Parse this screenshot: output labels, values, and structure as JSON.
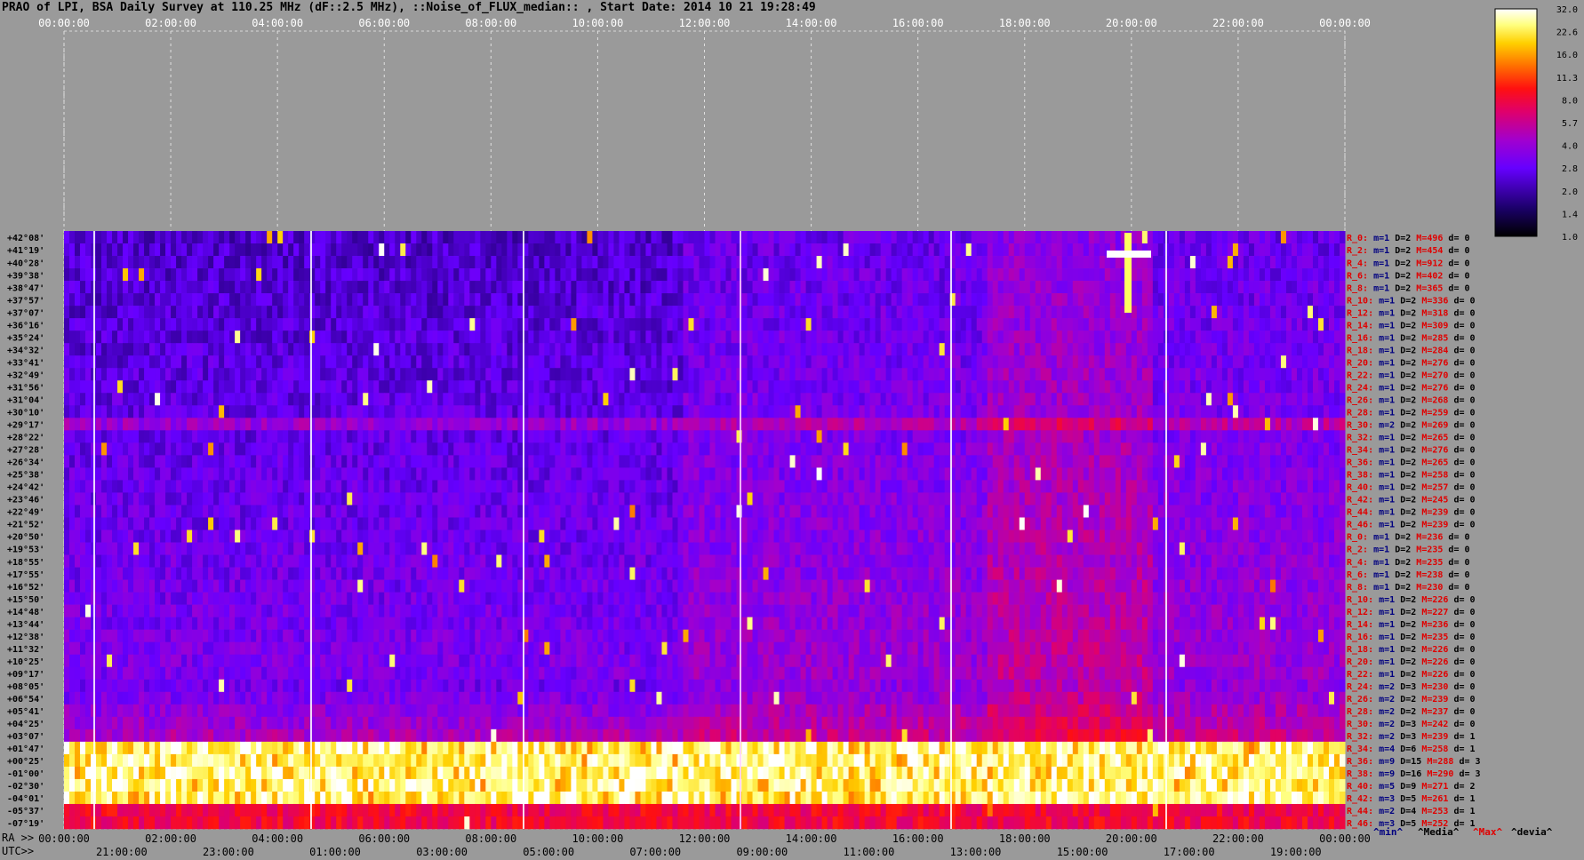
{
  "title": "PRAO of LPI, BSA Daily Survey at 110.25 MHz (dF::2.5 MHz), ::Noise_of_FLUX_median:: , Start Date: 2014 10 21 19:28:49",
  "axis_labels": {
    "ra": "RA >>",
    "utc": "UTC>>"
  },
  "legend_keys": {
    "min": "^min^",
    "median": "^Media^",
    "max": "^Max^",
    "dev": "^devia^"
  },
  "colors": {
    "background": "#9a9a9a",
    "low": "#000000",
    "mid": "#7a00ff",
    "high": "#ff0000",
    "peak": "#ffffff",
    "stat_red": "#e00000",
    "stat_blue": "#000080"
  },
  "chart_data": {
    "type": "heatmap",
    "x_ticks_top": [
      "00:00:00",
      "02:00:00",
      "04:00:00",
      "06:00:00",
      "08:00:00",
      "10:00:00",
      "12:00:00",
      "14:00:00",
      "16:00:00",
      "18:00:00",
      "20:00:00",
      "22:00:00",
      "00:00:00"
    ],
    "x_ticks_ra": [
      "00:00:00",
      "02:00:00",
      "04:00:00",
      "06:00:00",
      "08:00:00",
      "10:00:00",
      "12:00:00",
      "14:00:00",
      "16:00:00",
      "18:00:00",
      "20:00:00",
      "22:00:00",
      "00:00:00"
    ],
    "x_ticks_utc": [
      "21:00:00",
      "23:00:00",
      "01:00:00",
      "03:00:00",
      "05:00:00",
      "07:00:00",
      "09:00:00",
      "11:00:00",
      "13:00:00",
      "15:00:00",
      "17:00:00",
      "19:00:00"
    ],
    "y_labels": [
      "+42°08'",
      "+41°19'",
      "+40°28'",
      "+39°38'",
      "+38°47'",
      "+37°57'",
      "+37°07'",
      "+36°16'",
      "+35°24'",
      "+34°32'",
      "+33°41'",
      "+32°49'",
      "+31°56'",
      "+31°04'",
      "+30°10'",
      "+29°17'",
      "+28°22'",
      "+27°28'",
      "+26°34'",
      "+25°38'",
      "+24°42'",
      "+23°46'",
      "+22°49'",
      "+21°52'",
      "+20°50'",
      "+19°53'",
      "+18°55'",
      "+17°55'",
      "+16°52'",
      "+15°50'",
      "+14°48'",
      "+13°44'",
      "+12°38'",
      "+11°32'",
      "+10°25'",
      "+09°17'",
      "+08°05'",
      "+06°54'",
      "+05°41'",
      "+04°25'",
      "+03°07'",
      "+01°47'",
      "+00°25'",
      "-01°00'",
      "-02°30'",
      "-04°01'",
      "-05°37'",
      "-07°19'"
    ],
    "colorbar": {
      "ticks": [
        "32.0",
        "22.6",
        "16.0",
        "11.3",
        "8.0",
        "5.7",
        "4.0",
        "2.8",
        "2.0",
        "1.4",
        "1.0"
      ],
      "range": [
        1.0,
        32.0
      ],
      "scale": "log"
    },
    "row_stats": [
      {
        "r": "R_0:",
        "m": "m=1",
        "D": "D=2",
        "M": "M=496",
        "d": "d= 0"
      },
      {
        "r": "R_2:",
        "m": "m=1",
        "D": "D=2",
        "M": "M=454",
        "d": "d= 0"
      },
      {
        "r": "R_4:",
        "m": "m=1",
        "D": "D=2",
        "M": "M=912",
        "d": "d= 0"
      },
      {
        "r": "R_6:",
        "m": "m=1",
        "D": "D=2",
        "M": "M=402",
        "d": "d= 0"
      },
      {
        "r": "R_8:",
        "m": "m=1",
        "D": "D=2",
        "M": "M=365",
        "d": "d= 0"
      },
      {
        "r": "R_10:",
        "m": "m=1",
        "D": "D=2",
        "M": "M=336",
        "d": "d= 0"
      },
      {
        "r": "R_12:",
        "m": "m=1",
        "D": "D=2",
        "M": "M=318",
        "d": "d= 0"
      },
      {
        "r": "R_14:",
        "m": "m=1",
        "D": "D=2",
        "M": "M=309",
        "d": "d= 0"
      },
      {
        "r": "R_16:",
        "m": "m=1",
        "D": "D=2",
        "M": "M=285",
        "d": "d= 0"
      },
      {
        "r": "R_18:",
        "m": "m=1",
        "D": "D=2",
        "M": "M=284",
        "d": "d= 0"
      },
      {
        "r": "R_20:",
        "m": "m=1",
        "D": "D=2",
        "M": "M=276",
        "d": "d= 0"
      },
      {
        "r": "R_22:",
        "m": "m=1",
        "D": "D=2",
        "M": "M=270",
        "d": "d= 0"
      },
      {
        "r": "R_24:",
        "m": "m=1",
        "D": "D=2",
        "M": "M=276",
        "d": "d= 0"
      },
      {
        "r": "R_26:",
        "m": "m=1",
        "D": "D=2",
        "M": "M=268",
        "d": "d= 0"
      },
      {
        "r": "R_28:",
        "m": "m=1",
        "D": "D=2",
        "M": "M=259",
        "d": "d= 0"
      },
      {
        "r": "R_30:",
        "m": "m=2",
        "D": "D=2",
        "M": "M=269",
        "d": "d= 0"
      },
      {
        "r": "R_32:",
        "m": "m=1",
        "D": "D=2",
        "M": "M=265",
        "d": "d= 0"
      },
      {
        "r": "R_34:",
        "m": "m=1",
        "D": "D=2",
        "M": "M=276",
        "d": "d= 0"
      },
      {
        "r": "R_36:",
        "m": "m=1",
        "D": "D=2",
        "M": "M=265",
        "d": "d= 0"
      },
      {
        "r": "R_38:",
        "m": "m=1",
        "D": "D=2",
        "M": "M=258",
        "d": "d= 0"
      },
      {
        "r": "R_40:",
        "m": "m=1",
        "D": "D=2",
        "M": "M=257",
        "d": "d= 0"
      },
      {
        "r": "R_42:",
        "m": "m=1",
        "D": "D=2",
        "M": "M=245",
        "d": "d= 0"
      },
      {
        "r": "R_44:",
        "m": "m=1",
        "D": "D=2",
        "M": "M=239",
        "d": "d= 0"
      },
      {
        "r": "R_46:",
        "m": "m=1",
        "D": "D=2",
        "M": "M=239",
        "d": "d= 0"
      },
      {
        "r": "R_0:",
        "m": "m=1",
        "D": "D=2",
        "M": "M=236",
        "d": "d= 0"
      },
      {
        "r": "R_2:",
        "m": "m=1",
        "D": "D=2",
        "M": "M=235",
        "d": "d= 0"
      },
      {
        "r": "R_4:",
        "m": "m=1",
        "D": "D=2",
        "M": "M=235",
        "d": "d= 0"
      },
      {
        "r": "R_6:",
        "m": "m=1",
        "D": "D=2",
        "M": "M=238",
        "d": "d= 0"
      },
      {
        "r": "R_8:",
        "m": "m=1",
        "D": "D=2",
        "M": "M=230",
        "d": "d= 0"
      },
      {
        "r": "R_10:",
        "m": "m=1",
        "D": "D=2",
        "M": "M=226",
        "d": "d= 0"
      },
      {
        "r": "R_12:",
        "m": "m=1",
        "D": "D=2",
        "M": "M=227",
        "d": "d= 0"
      },
      {
        "r": "R_14:",
        "m": "m=1",
        "D": "D=2",
        "M": "M=236",
        "d": "d= 0"
      },
      {
        "r": "R_16:",
        "m": "m=1",
        "D": "D=2",
        "M": "M=235",
        "d": "d= 0"
      },
      {
        "r": "R_18:",
        "m": "m=1",
        "D": "D=2",
        "M": "M=226",
        "d": "d= 0"
      },
      {
        "r": "R_20:",
        "m": "m=1",
        "D": "D=2",
        "M": "M=226",
        "d": "d= 0"
      },
      {
        "r": "R_22:",
        "m": "m=1",
        "D": "D=2",
        "M": "M=226",
        "d": "d= 0"
      },
      {
        "r": "R_24:",
        "m": "m=2",
        "D": "D=3",
        "M": "M=230",
        "d": "d= 0"
      },
      {
        "r": "R_26:",
        "m": "m=2",
        "D": "D=2",
        "M": "M=239",
        "d": "d= 0"
      },
      {
        "r": "R_28:",
        "m": "m=2",
        "D": "D=2",
        "M": "M=237",
        "d": "d= 0"
      },
      {
        "r": "R_30:",
        "m": "m=2",
        "D": "D=3",
        "M": "M=242",
        "d": "d= 0"
      },
      {
        "r": "R_32:",
        "m": "m=2",
        "D": "D=3",
        "M": "M=239",
        "d": "d= 1"
      },
      {
        "r": "R_34:",
        "m": "m=4",
        "D": "D=6",
        "M": "M=258",
        "d": "d= 1"
      },
      {
        "r": "R_36:",
        "m": "m=9",
        "D": "D=15",
        "M": "M=288",
        "d": "d= 3"
      },
      {
        "r": "R_38:",
        "m": "m=9",
        "D": "D=16",
        "M": "M=290",
        "d": "d= 3"
      },
      {
        "r": "R_40:",
        "m": "m=5",
        "D": "D=9",
        "M": "M=271",
        "d": "d= 2"
      },
      {
        "r": "R_42:",
        "m": "m=3",
        "D": "D=5",
        "M": "M=261",
        "d": "d= 1"
      },
      {
        "r": "R_44:",
        "m": "m=2",
        "D": "D=4",
        "M": "M=253",
        "d": "d= 1"
      },
      {
        "r": "R_46:",
        "m": "m=3",
        "D": "D=5",
        "M": "M=252",
        "d": "d= 1"
      }
    ]
  }
}
